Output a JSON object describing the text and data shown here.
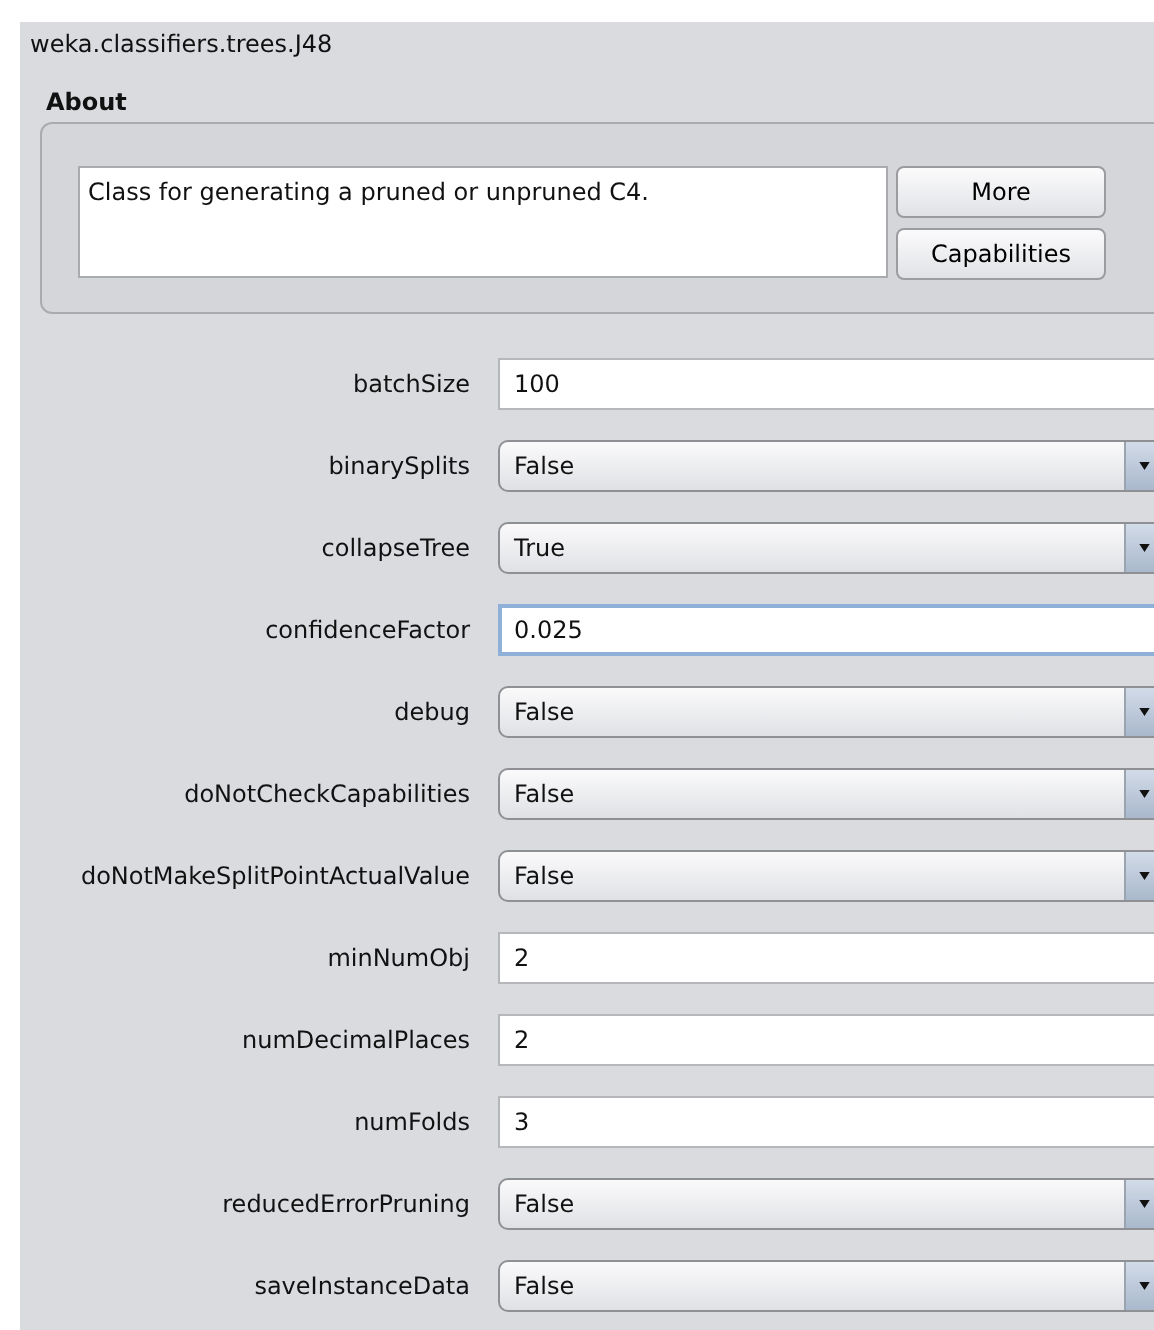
{
  "window": {
    "title": "weka.classifiers.trees.J48"
  },
  "about": {
    "label": "About",
    "text": "Class for generating a pruned or unpruned C4.",
    "buttons": [
      "More",
      "Capabilities"
    ]
  },
  "properties": [
    {
      "name": "batchSize",
      "kind": "text",
      "value": "100",
      "focused": false
    },
    {
      "name": "binarySplits",
      "kind": "dropdown",
      "value": "False"
    },
    {
      "name": "collapseTree",
      "kind": "dropdown",
      "value": "True"
    },
    {
      "name": "confidenceFactor",
      "kind": "text",
      "value": "0.025",
      "focused": true
    },
    {
      "name": "debug",
      "kind": "dropdown",
      "value": "False"
    },
    {
      "name": "doNotCheckCapabilities",
      "kind": "dropdown",
      "value": "False"
    },
    {
      "name": "doNotMakeSplitPointActualValue",
      "kind": "dropdown",
      "value": "False"
    },
    {
      "name": "minNumObj",
      "kind": "text",
      "value": "2",
      "focused": false
    },
    {
      "name": "numDecimalPlaces",
      "kind": "text",
      "value": "2",
      "focused": false
    },
    {
      "name": "numFolds",
      "kind": "text",
      "value": "3",
      "focused": false
    },
    {
      "name": "reducedErrorPruning",
      "kind": "dropdown",
      "value": "False"
    },
    {
      "name": "saveInstanceData",
      "kind": "dropdown",
      "value": "False"
    }
  ]
}
